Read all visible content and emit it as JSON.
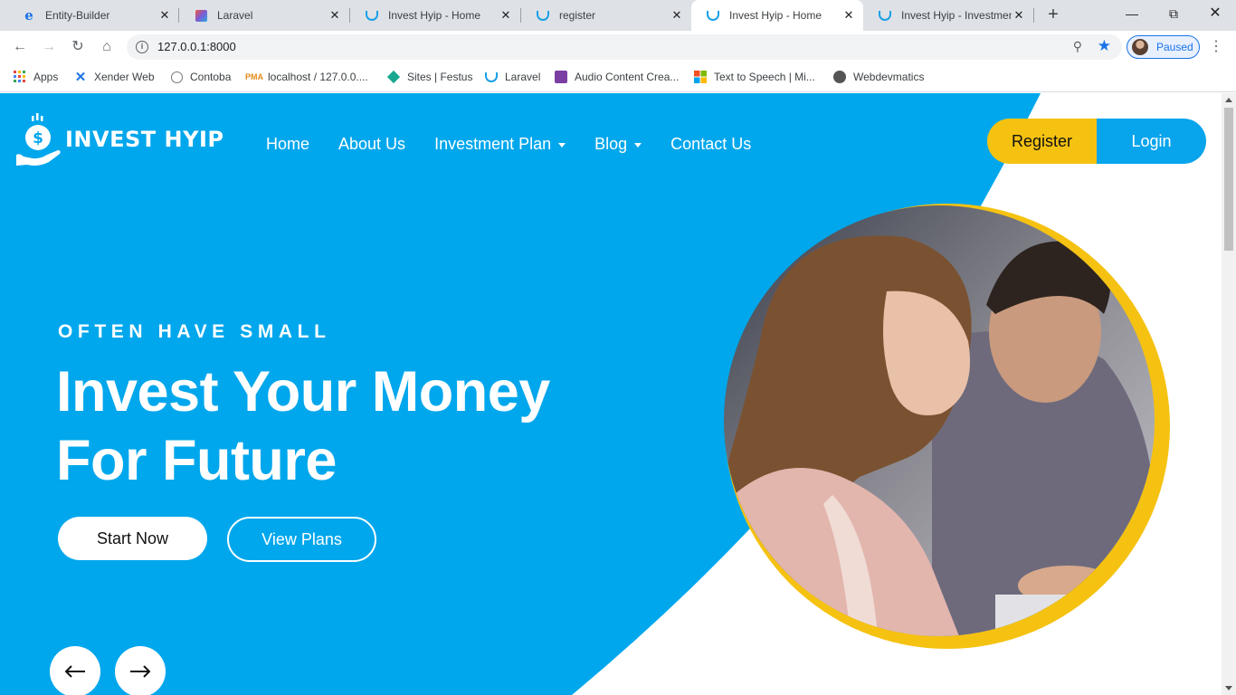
{
  "browser": {
    "tabs": [
      {
        "title": "Entity-Builder",
        "icon": "ie-icon"
      },
      {
        "title": "Laravel",
        "icon": "laravel-icon"
      },
      {
        "title": "Invest Hyip - Home",
        "icon": "hyip-icon"
      },
      {
        "title": "register",
        "icon": "hyip-icon"
      },
      {
        "title": "Invest Hyip - Home",
        "icon": "hyip-icon",
        "active": true
      },
      {
        "title": "Invest Hyip - Investmen",
        "icon": "hyip-icon"
      }
    ],
    "url": "127.0.0.1:8000",
    "profile_status": "Paused",
    "bookmarks": [
      {
        "label": "Apps",
        "icon": "apps-grid-icon"
      },
      {
        "label": "Xender Web",
        "icon": "xender-icon"
      },
      {
        "label": "Contoba",
        "icon": "contoba-icon"
      },
      {
        "label": "localhost / 127.0.0....",
        "icon": "phpmyadmin-icon"
      },
      {
        "label": "Sites | Festus",
        "icon": "diamond-icon"
      },
      {
        "label": "Laravel",
        "icon": "hyip-icon"
      },
      {
        "label": "Audio Content Crea...",
        "icon": "audio-icon"
      },
      {
        "label": "Text to Speech | Mi...",
        "icon": "microsoft-icon"
      },
      {
        "label": "Webdevmatics",
        "icon": "globe-icon"
      }
    ]
  },
  "site": {
    "logo_text": "INVEST HYIP",
    "nav": [
      {
        "label": "Home",
        "dropdown": false
      },
      {
        "label": "About Us",
        "dropdown": false
      },
      {
        "label": "Investment Plan",
        "dropdown": true
      },
      {
        "label": "Blog",
        "dropdown": true
      },
      {
        "label": "Contact Us",
        "dropdown": false
      }
    ],
    "register_label": "Register",
    "login_label": "Login",
    "hero": {
      "eyebrow": "OFTEN HAVE SMALL",
      "headline_line1": "Invest Your Money",
      "headline_line2": "For Future",
      "start_label": "Start Now",
      "plans_label": "View Plans"
    },
    "colors": {
      "primary_blue": "#00a7ec",
      "accent_yellow": "#f5c211"
    }
  }
}
